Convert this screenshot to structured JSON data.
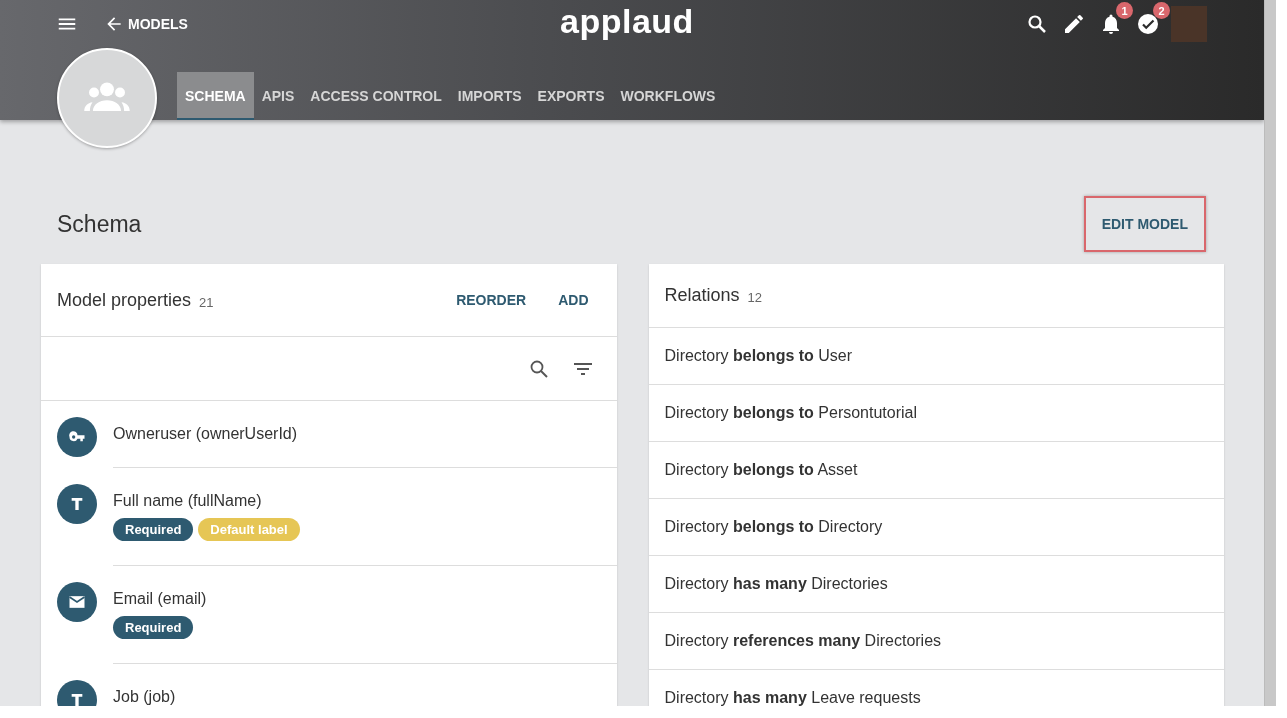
{
  "header": {
    "back_label": "MODELS",
    "logo": "applaud",
    "notifications": [
      {
        "kind": "bell",
        "count": "1"
      },
      {
        "kind": "check",
        "count": "2"
      }
    ]
  },
  "tabs": [
    {
      "label": "SCHEMA",
      "selected": true
    },
    {
      "label": "APIS",
      "selected": false
    },
    {
      "label": "ACCESS CONTROL",
      "selected": false
    },
    {
      "label": "IMPORTS",
      "selected": false
    },
    {
      "label": "EXPORTS",
      "selected": false
    },
    {
      "label": "WORKFLOWS",
      "selected": false
    }
  ],
  "page_title": "Schema",
  "edit_button": "EDIT MODEL",
  "properties": {
    "title": "Model properties",
    "count": "21",
    "actions": [
      "REORDER",
      "ADD"
    ],
    "items": [
      {
        "kind": "key",
        "name": "Owneruser (ownerUserId)"
      },
      {
        "kind": "text",
        "name": "Full name (fullName)",
        "tags": [
          {
            "label": "Required",
            "color": "#2e5a70"
          },
          {
            "label": "Default label",
            "color": "#e6c655"
          }
        ]
      },
      {
        "kind": "email",
        "name": "Email (email)",
        "tags": [
          {
            "label": "Required",
            "color": "#2e5a70"
          }
        ]
      },
      {
        "kind": "text",
        "name": "Job (job)"
      }
    ]
  },
  "relations": {
    "title": "Relations",
    "count": "12",
    "items": [
      "Directory **belongs to** User",
      "Directory **belongs to** Persontutorial",
      "Directory **belongs to** Asset",
      "Directory **belongs to** Directory",
      "Directory **has many** Directories",
      "Directory **references many** Directories",
      "Directory **has many** Leave requests"
    ]
  }
}
